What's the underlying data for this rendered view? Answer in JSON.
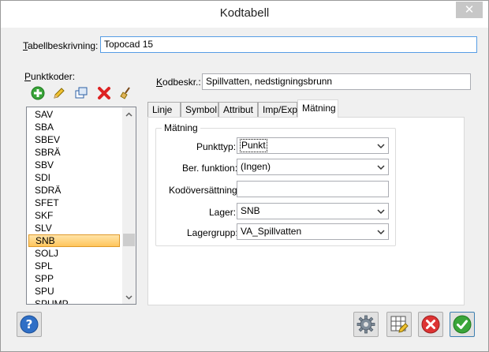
{
  "window": {
    "title": "Kodtabell",
    "close_glyph": "✕"
  },
  "header": {
    "table_desc_label_first": "T",
    "table_desc_label_rest": "abellbeskrivning:",
    "table_desc_value": "Topocad 15"
  },
  "punktkoder": {
    "label_first": "P",
    "label_rest": "unktkoder:",
    "toolbar": [
      "add-icon",
      "edit-pencil-icon",
      "copy-icon",
      "delete-x-icon",
      "broom-icon"
    ],
    "items": [
      "SAV",
      "SBA",
      "SBEV",
      "SBRÄ",
      "SBV",
      "SDI",
      "SDRÄ",
      "SFET",
      "SKF",
      "SLV",
      "SNB",
      "SOLJ",
      "SPL",
      "SPP",
      "SPU",
      "SPUMP"
    ],
    "selected_index": 10
  },
  "code_desc": {
    "label_first": "K",
    "label_rest": "odbeskr.:",
    "value": "Spillvatten, nedstigningsbrunn"
  },
  "tabs": [
    {
      "label": "Linje"
    },
    {
      "label": "Symbol"
    },
    {
      "label": "Attribut"
    },
    {
      "label": "Imp/Exp"
    },
    {
      "label": "Mätning"
    }
  ],
  "active_tab": "Mätning",
  "matning": {
    "group_title": "Mätning",
    "punkttyp_label": "Punkttyp:",
    "punkttyp_value": "Punkt",
    "ber_funktion_label": "Ber. funktion:",
    "ber_funktion_value": "(Ingen)",
    "kodoversattning_label": "Kodöversättning:",
    "kodoversattning_value": "",
    "lager_label": "Lager:",
    "lager_value": "SNB",
    "lagergrupp_label": "Lagergrupp:",
    "lagergrupp_value": "VA_Spillvatten"
  },
  "buttons": {
    "help": "help-icon",
    "settings": "gear-icon",
    "grid_edit": "table-edit-icon",
    "cancel": "cancel-icon",
    "ok": "ok-check-icon"
  },
  "colors": {
    "selection": "#ffc65c",
    "selection_border": "#e09a2a",
    "focus_border": "#569de5",
    "ok_green": "#3aa53a",
    "cancel_red": "#d33"
  }
}
